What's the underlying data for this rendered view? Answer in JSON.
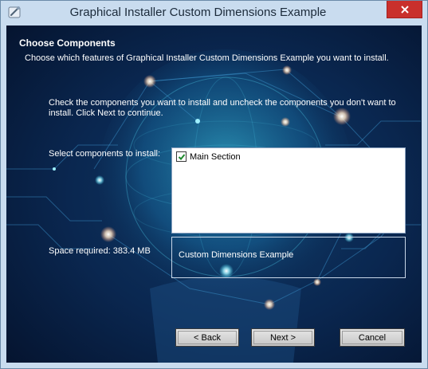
{
  "window": {
    "title": "Graphical Installer Custom Dimensions Example",
    "title_icon": "installer-icon",
    "close_icon": "close-icon"
  },
  "page": {
    "heading": "Choose Components",
    "subheading": "Choose which features of Graphical Installer Custom Dimensions Example you want to install.",
    "instructions": "Check the components you want to install and uncheck the components you don't want to install. Click Next to continue.",
    "select_label": "Select components to install:",
    "space_required": "Space required: 383.4 MB"
  },
  "components": [
    {
      "label": "Main Section",
      "checked": true
    }
  ],
  "description": {
    "text": "Custom Dimensions Example"
  },
  "buttons": {
    "back_label": "< Back",
    "next_label": "Next >",
    "cancel_label": "Cancel"
  },
  "colors": {
    "background": "#071a36",
    "accent_glow": "#3fd6f0",
    "close_button": "#c9302c",
    "title_bar": "#c9dcef"
  }
}
